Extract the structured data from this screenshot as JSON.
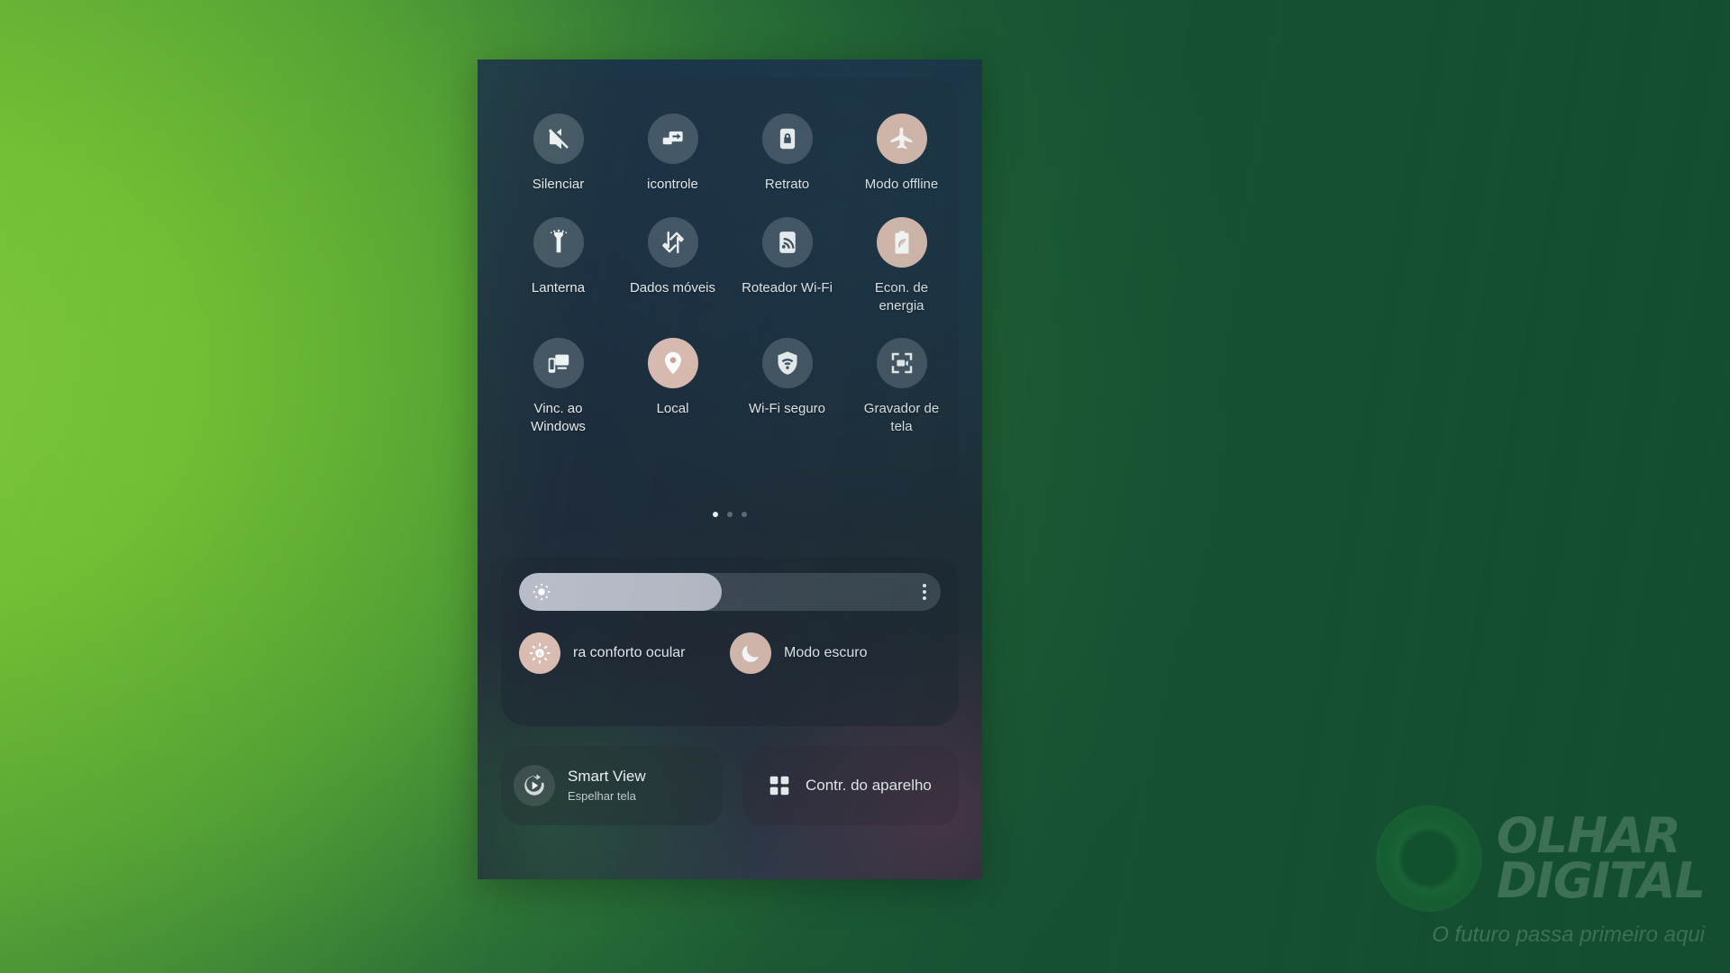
{
  "background": {
    "gradient_from": "#7cc63a",
    "gradient_to": "#175435"
  },
  "phone": {
    "accent_active": "#dcbdb2",
    "tile_inactive": "rgba(126,140,152,.42)"
  },
  "quick_settings": {
    "tiles": [
      {
        "label": "Silenciar",
        "icon": "mute-icon",
        "active": false
      },
      {
        "label": "icontrole",
        "icon": "multicontrol-icon",
        "active": false
      },
      {
        "label": "Retrato",
        "icon": "screen-lock-icon",
        "active": false
      },
      {
        "label": "Modo offline",
        "icon": "airplane-icon",
        "active": true
      },
      {
        "label": "Lanterna",
        "icon": "flashlight-icon",
        "active": false
      },
      {
        "label": "Dados móveis",
        "icon": "mobile-data-icon",
        "active": false
      },
      {
        "label": "Roteador Wi-Fi",
        "icon": "hotspot-icon",
        "active": false
      },
      {
        "label": "Econ. de energia",
        "icon": "battery-saver-icon",
        "active": true
      },
      {
        "label": "Vinc. ao Windows",
        "icon": "link-to-windows-icon",
        "active": false
      },
      {
        "label": "Local",
        "icon": "location-pin-icon",
        "active": true
      },
      {
        "label": "Wi-Fi seguro",
        "icon": "secure-wifi-icon",
        "active": false
      },
      {
        "label": "Gravador de tela",
        "icon": "screen-recorder-icon",
        "active": false
      }
    ],
    "pages": {
      "count": 3,
      "active_index": 0
    }
  },
  "display": {
    "brightness": {
      "value_percent": 48,
      "sun_icon": "brightness-sun-icon",
      "more_icon": "more-options-icon"
    },
    "modes": [
      {
        "label": "ra conforto ocular",
        "icon": "eye-comfort-icon",
        "active": true
      },
      {
        "label": "Modo escuro",
        "icon": "moon-icon",
        "active": true
      }
    ]
  },
  "bottom_buttons": {
    "smart_view": {
      "title": "Smart View",
      "subtitle": "Espelhar tela",
      "icon": "cast-play-icon"
    },
    "device_control": {
      "title": "Contr. do aparelho",
      "icon": "grid-squares-icon"
    }
  },
  "watermark": {
    "line1": "OLHAR",
    "line2": "DIGITAL",
    "tagline": "O futuro passa primeiro aqui"
  }
}
